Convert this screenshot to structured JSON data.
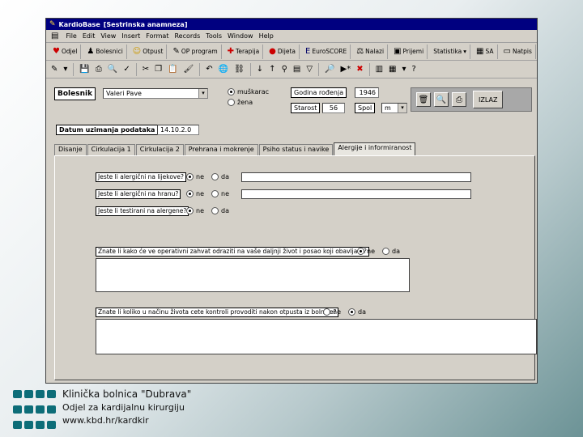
{
  "window": {
    "title_app": "KardioBase",
    "title_form": "[Sestrinska anamneza]"
  },
  "menubar": [
    "File",
    "Edit",
    "View",
    "Insert",
    "Format",
    "Records",
    "Tools",
    "Window",
    "Help"
  ],
  "toolbar": {
    "odjel": "Odjel",
    "bolesnici": "Bolesnici",
    "otpust": "Otpust",
    "op_program": "OP program",
    "terapija": "Terapija",
    "dijeta": "Dijeta",
    "euroscore": "EuroSCORE",
    "nalazi": "Nalazi",
    "prijemi": "Prijemi",
    "statistika": "Statistika",
    "sa": "SA",
    "natpis": "Natpis"
  },
  "patient": {
    "label": "Bolesnik",
    "name": "Valeri Pave",
    "gender_options": [
      {
        "label": "muškarac",
        "selected": true
      },
      {
        "label": "žena",
        "selected": false
      }
    ],
    "birth_year_label": "Godina rođenja",
    "birth_year": "1946",
    "age_label": "Starost",
    "age": "56",
    "sex_label": "Spol",
    "sex": "m"
  },
  "panel": {
    "exit_label": "IZLAZ"
  },
  "date": {
    "label": "Datum uzimanja podataka",
    "value": "14.10.2.0"
  },
  "tabs": [
    {
      "label": "Disanje",
      "active": false
    },
    {
      "label": "Cirkulacija 1",
      "active": false
    },
    {
      "label": "Cirkulacija 2",
      "active": false
    },
    {
      "label": "Prehrana i mokrenje",
      "active": false
    },
    {
      "label": "Psiho status i navike",
      "active": false
    },
    {
      "label": "Alergije i informiranost",
      "active": true
    }
  ],
  "questions": [
    {
      "text": "Jeste li alergični na lijekove?",
      "no": "ne",
      "yes": "da",
      "selected": "ne"
    },
    {
      "text": "Jeste li alergični na hranu?",
      "no": "ne",
      "yes": "ne",
      "selected": "ne"
    },
    {
      "text": "Jeste li testirani na alergene?",
      "no": "ne",
      "yes": "da",
      "selected": "ne"
    },
    {
      "text": "Znate li kako će ve operativni zahvat odraziti na vaše daljnji život i posao koji obavljate?",
      "no": "ne",
      "yes": "da",
      "selected": "ne"
    },
    {
      "text": "Znate li koliko u načinu života cete kontroli provoditi nakon otpusta iz bolnice?",
      "no": "ne",
      "yes": "da",
      "selected": "da"
    }
  ],
  "footer": {
    "line1": "Klinička bolnica \"Dubrava\"",
    "line2": "Odjel za kardijalnu kirurgiju",
    "line3": "www.kbd.hr/kardkir"
  },
  "colors": {
    "titlebar": "#000080",
    "window": "#d4d0c8",
    "footer_bars": "#0d6d78"
  }
}
